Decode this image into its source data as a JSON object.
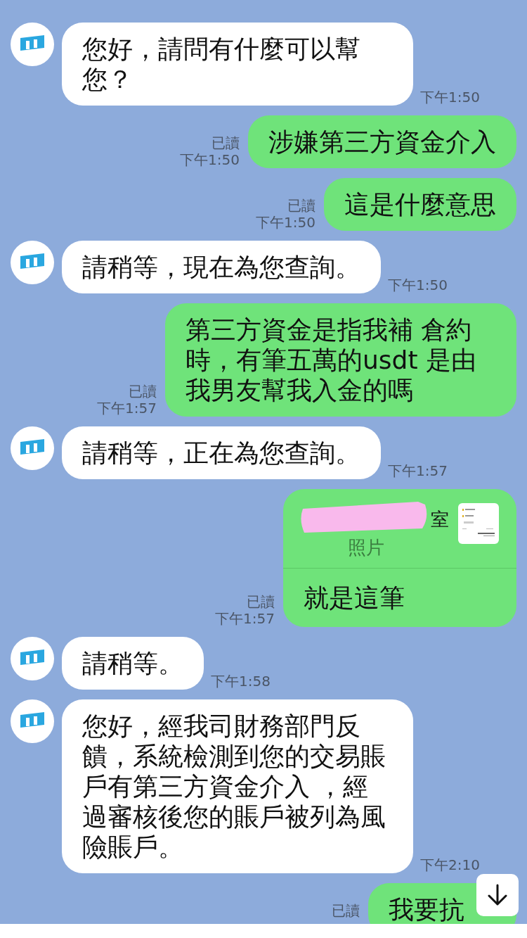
{
  "messages": [
    {
      "kind": "incoming",
      "text": "您好，請問有什麼可以幫您？",
      "time": "下午1:50"
    },
    {
      "kind": "outgoing",
      "text": "涉嫌第三方資金介入",
      "read": "已讀",
      "time": "下午1:50"
    },
    {
      "kind": "outgoing",
      "text": "這是什麼意思",
      "read": "已讀",
      "time": "下午1:50"
    },
    {
      "kind": "incoming",
      "text": "請稍等，現在為您查詢。",
      "time": "下午1:50"
    },
    {
      "kind": "outgoing",
      "text": "第三方資金是指我補 倉約時，有筆五萬的usdt 是由我男友幫我入金的嗎",
      "read": "已讀",
      "time": "下午1:57"
    },
    {
      "kind": "incoming",
      "text": "請稍等，正在為您查詢。",
      "time": "下午1:57"
    },
    {
      "kind": "outgoing_reply",
      "reply": {
        "name": "室",
        "label": "照片"
      },
      "text": "就是這筆",
      "read": "已讀",
      "time": "下午1:57"
    },
    {
      "kind": "incoming",
      "text": "請稍等。",
      "time": "下午1:58"
    },
    {
      "kind": "incoming",
      "text": "您好，經我司財務部門反饋，系統檢測到您的交易賬戶有第三方資金介入 ，經過審核後您的賬戶被列為風險賬戶。",
      "time": "下午2:10"
    },
    {
      "kind": "outgoing",
      "text": "我要抗",
      "read": "已讀"
    }
  ]
}
